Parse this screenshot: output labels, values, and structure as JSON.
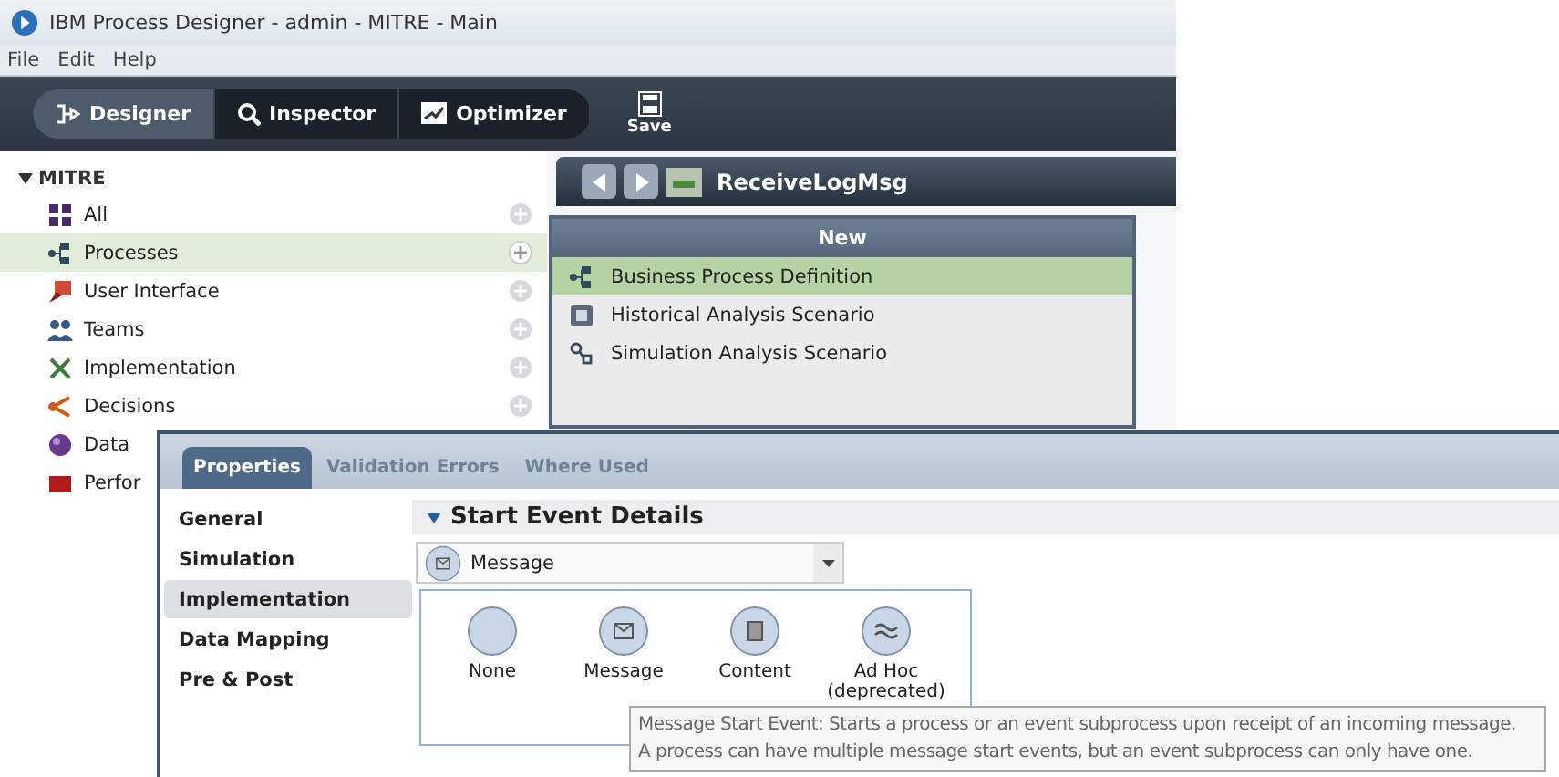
{
  "window": {
    "title": "IBM Process Designer -  admin - MITRE - Main"
  },
  "menu": [
    "File",
    "Edit",
    "Help"
  ],
  "modes": [
    {
      "label": "Designer",
      "kind": "designer",
      "selected": true
    },
    {
      "label": "Inspector",
      "kind": "inspector",
      "selected": false
    },
    {
      "label": "Optimizer",
      "kind": "optimizer",
      "selected": false
    }
  ],
  "save_button": "Save",
  "tree": {
    "label": "MITRE",
    "expanded": true,
    "children": [
      {
        "label": "All",
        "kind": "grid",
        "selected": false
      },
      {
        "label": "Processes",
        "kind": "process",
        "selected": true
      },
      {
        "label": "User Interface",
        "kind": "ui",
        "selected": false
      },
      {
        "label": "Teams",
        "kind": "team",
        "selected": false
      },
      {
        "label": "Implementation",
        "kind": "tools",
        "selected": false
      },
      {
        "label": "Decisions",
        "kind": "decision",
        "selected": false
      },
      {
        "label": "Data",
        "kind": "data",
        "selected": false
      },
      {
        "label": "Perfor",
        "kind": "folder",
        "selected": false
      }
    ]
  },
  "editor": {
    "title": "ReceiveLogMsg"
  },
  "new_menu": {
    "title": "New",
    "items": [
      {
        "label": "Business Process Definition",
        "kind": "process",
        "selected": true
      },
      {
        "label": "Historical Analysis Scenario",
        "kind": "history",
        "selected": false
      },
      {
        "label": "Simulation Analysis Scenario",
        "kind": "simulation",
        "selected": false
      }
    ]
  },
  "properties": {
    "tabs": [
      {
        "label": "Properties",
        "selected": true
      },
      {
        "label": "Validation Errors",
        "selected": false
      },
      {
        "label": "Where Used",
        "selected": false
      }
    ],
    "nav": [
      {
        "label": "General",
        "selected": false
      },
      {
        "label": "Simulation",
        "selected": false
      },
      {
        "label": "Implementation",
        "selected": true
      },
      {
        "label": "Data Mapping",
        "selected": false
      },
      {
        "label": "Pre & Post",
        "selected": false
      }
    ],
    "section": "Start Event Details",
    "event_type": "Message",
    "event_options": [
      {
        "label": "None",
        "kind": "none"
      },
      {
        "label": "Message",
        "kind": "message"
      },
      {
        "label": "Content",
        "kind": "content"
      },
      {
        "label": "Ad Hoc (deprecated)",
        "kind": "adhoc"
      }
    ],
    "tooltip": [
      "Message Start Event: Starts a process or an event subprocess upon receipt of an incoming message.",
      "A process can have multiple message start events, but an event subprocess can only have one."
    ]
  }
}
